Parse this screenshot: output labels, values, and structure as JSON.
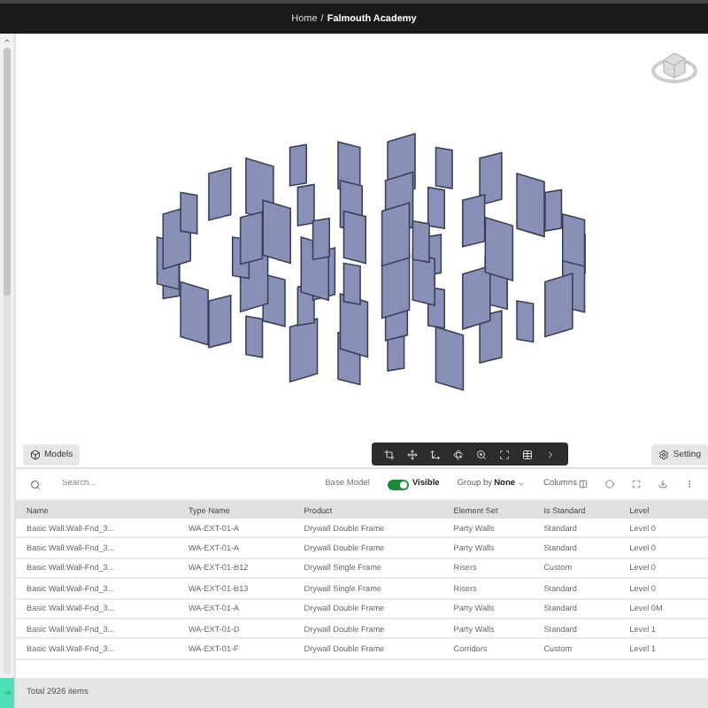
{
  "breadcrumb": {
    "home": "Home",
    "separator": "/",
    "current": "Falmouth Academy"
  },
  "viewer": {
    "models_button": "Models",
    "settings_button": "Setting"
  },
  "table_toolbar": {
    "search": {
      "placeholder": "Search..."
    },
    "base_model_label": "Base Model",
    "base_model": {
      "on": true,
      "label": "Visible"
    },
    "group_by_label": "Group by",
    "group_by_value": "None",
    "columns_button": "Columns"
  },
  "table": {
    "columns": [
      "Name",
      "Type Name",
      "Product",
      "Element Set",
      "Is Standard",
      "Level"
    ],
    "rows": [
      [
        "Basic Wall:Wall-Fnd_3...",
        "WA-EXT-01-A",
        "Drywall Double Frame",
        "Party Walls",
        "Standard",
        "Level 0"
      ],
      [
        "Basic Wall:Wall-Fnd_3...",
        "WA-EXT-01-A",
        "Drywall Double Frame",
        "Party Walls",
        "Standard",
        "Level 0"
      ],
      [
        "Basic Wall:Wall-Fnd_3...",
        "WA-EXT-01-B12",
        "Drywall Single Frame",
        "Risers",
        "Custom",
        "Level 0"
      ],
      [
        "Basic Wall:Wall-Fnd_3...",
        "WA-EXT-01-B13",
        "Drywall Single Frame",
        "Risers",
        "Standard",
        "Level 0"
      ],
      [
        "Basic Wall:Wall-Fnd_3...",
        "WA-EXT-01-A",
        "Drywall Double Frame",
        "Party Walls",
        "Standard",
        "Level 0M"
      ],
      [
        "Basic Wall:Wall-Fnd_3...",
        "WA-EXT-01-D",
        "Drywall Double Frame",
        "Party Walls",
        "Standard",
        "Level 1"
      ],
      [
        "Basic Wall:Wall-Fnd_3...",
        "WA-EXT-01-F",
        "Drywall Double Frame",
        "Corridors",
        "Custom",
        "Level 1"
      ]
    ]
  },
  "status_bar": {
    "total": "Total 2926 items"
  }
}
